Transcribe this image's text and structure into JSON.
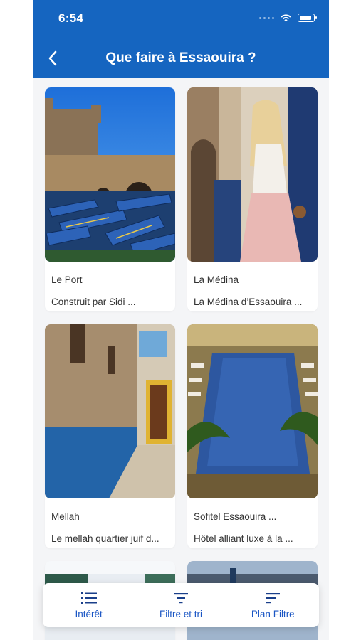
{
  "status_bar": {
    "time": "6:54"
  },
  "nav": {
    "title": "Que faire à Essaouira ?"
  },
  "cards": [
    {
      "title": "Le Port",
      "description": "Construit par Sidi ..."
    },
    {
      "title": "La Médina",
      "description": "La Médina d’Essaouira ..."
    },
    {
      "title": "Mellah",
      "description": "Le mellah quartier juif d..."
    },
    {
      "title": "Sofitel Essaouira ...",
      "description": "Hôtel alliant luxe à la ..."
    }
  ],
  "bottom_bar": {
    "items": [
      {
        "label": "Intérêt",
        "icon": "list-icon"
      },
      {
        "label": "Filtre et tri",
        "icon": "filter-icon"
      },
      {
        "label": "Plan Filtre",
        "icon": "sort-lines-icon"
      }
    ]
  },
  "colors": {
    "primary": "#1565c0",
    "accent_text": "#1a56c4"
  }
}
